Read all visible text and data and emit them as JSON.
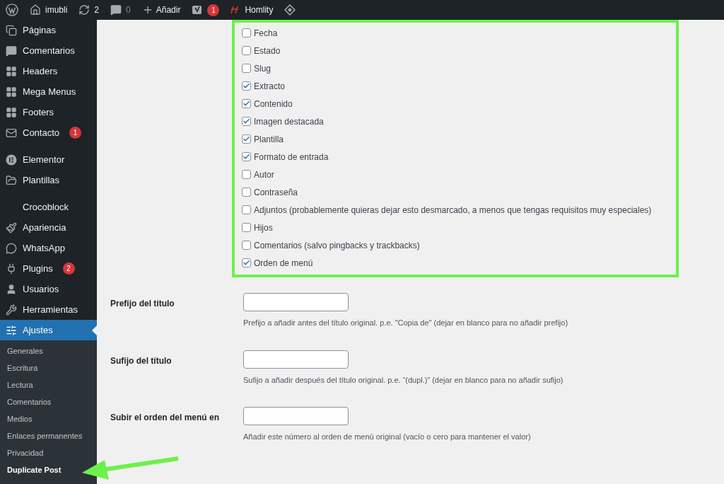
{
  "admin_bar": {
    "items": [
      {
        "kind": "wp"
      },
      {
        "kind": "site",
        "label": "imubli"
      },
      {
        "kind": "updates",
        "label": "2"
      },
      {
        "kind": "comments",
        "label": "0"
      },
      {
        "kind": "new",
        "label": "Añadir"
      },
      {
        "kind": "yoast",
        "badge": "1"
      },
      {
        "kind": "homlity",
        "label": "Homlity"
      },
      {
        "kind": "diamond"
      }
    ]
  },
  "sidebar": {
    "items": [
      {
        "kind": "pages",
        "label": "Páginas",
        "selected": false
      },
      {
        "kind": "comments",
        "label": "Comentarios",
        "selected": false
      },
      {
        "kind": "grid",
        "label": "Headers",
        "selected": false
      },
      {
        "kind": "grid",
        "label": "Mega Menus",
        "selected": false
      },
      {
        "kind": "grid",
        "label": "Footers",
        "selected": false
      },
      {
        "kind": "mail",
        "label": "Contacto",
        "badge": "1",
        "selected": false
      },
      {
        "kind": "spacer"
      },
      {
        "kind": "elementor",
        "label": "Elementor",
        "selected": false
      },
      {
        "kind": "folder",
        "label": "Plantillas",
        "selected": false
      },
      {
        "kind": "spacer"
      },
      {
        "kind": "none",
        "label": "Crocoblock",
        "selected": false
      },
      {
        "kind": "brush",
        "label": "Apariencia",
        "selected": false
      },
      {
        "kind": "whatsapp",
        "label": "WhatsApp",
        "selected": false
      },
      {
        "kind": "plug",
        "label": "Plugins",
        "badge": "2",
        "selected": false
      },
      {
        "kind": "user",
        "label": "Usuarios",
        "selected": false
      },
      {
        "kind": "wrench",
        "label": "Herramientas",
        "selected": false
      },
      {
        "kind": "settings",
        "label": "Ajustes",
        "selected": true
      }
    ],
    "submenu": [
      {
        "label": "Generales",
        "selected": false
      },
      {
        "label": "Escritura",
        "selected": false
      },
      {
        "label": "Lectura",
        "selected": false
      },
      {
        "label": "Comentarios",
        "selected": false
      },
      {
        "label": "Medios",
        "selected": false
      },
      {
        "label": "Enlaces permanentes",
        "selected": false
      },
      {
        "label": "Privacidad",
        "selected": false
      },
      {
        "label": "Duplicate Post",
        "selected": true
      }
    ]
  },
  "elements": [
    {
      "label": "Fecha",
      "checked": false
    },
    {
      "label": "Estado",
      "checked": false
    },
    {
      "label": "Slug",
      "checked": false
    },
    {
      "label": "Extracto",
      "checked": true
    },
    {
      "label": "Contenido",
      "checked": true
    },
    {
      "label": "Imagen destacada",
      "checked": true
    },
    {
      "label": "Plantilla",
      "checked": true
    },
    {
      "label": "Formato de entrada",
      "checked": true
    },
    {
      "label": "Autor",
      "checked": false
    },
    {
      "label": "Contraseña",
      "checked": false
    },
    {
      "label": "Adjuntos (probablemente quieras dejar esto desmarcado, a menos que tengas requisitos muy especiales)",
      "checked": false
    },
    {
      "label": "Hijos",
      "checked": false
    },
    {
      "label": "Comentarios (salvo pingbacks y trackbacks)",
      "checked": false
    },
    {
      "label": "Orden de menú",
      "checked": true
    }
  ],
  "fields": [
    {
      "label": "Prefijo del título",
      "description": "Prefijo a añadir antes del título original. p.e. \"Copia de\" (dejar en blanco para no añadir prefijo)"
    },
    {
      "label": "Sufijo del título",
      "description": "Sufijo a añadir después del título original. p.e. “(dupl.)” (dejar en blanco para no añadir sufijo)"
    },
    {
      "label": "Subir el orden del menú en",
      "description": "Añadir este número al orden de menú original (vacío o cero para mantener el valor)"
    }
  ]
}
